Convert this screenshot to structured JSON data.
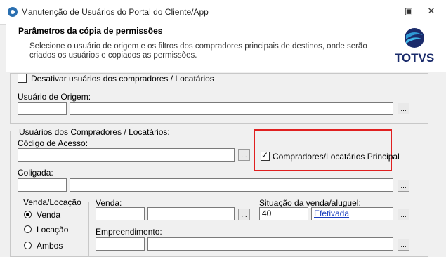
{
  "window": {
    "title": "Manutenção de Usuários do Portal do Cliente/App",
    "restore_icon": "restore-icon",
    "close_icon": "close-icon"
  },
  "header": {
    "title": "Parâmetros da cópia de permissões",
    "description": "Selecione o usuário de origem e os filtros dos compradores principais de destinos, onde serão criados os usuários e copiados as permissões.",
    "logo_text": "TOTVS",
    "logo_color": "#1a2b6b"
  },
  "origin": {
    "deactivate_label": "Desativar usuários dos compradores / Locatários",
    "user_label": "Usuário de Origem:",
    "lookup": "..."
  },
  "buyers": {
    "group_label": "Usuários dos Compradores / Locatários:",
    "access_code_label": "Código de Acesso:",
    "principal_label": "Compradores/Locatários Principal",
    "coligada_label": "Coligada:",
    "lookup": "..."
  },
  "venda_locacao": {
    "group_label": "Venda/Locação",
    "options": [
      "Venda",
      "Locação",
      "Ambos"
    ],
    "selected": "Venda"
  },
  "sale": {
    "venda_label": "Venda:",
    "situacao_label": "Situação da venda/aluguel:",
    "situacao_code": "40",
    "situacao_desc": "Efetivada",
    "empreendimento_label": "Empreendimento:",
    "lookup": "..."
  },
  "colors": {
    "highlight": "#e02020",
    "link": "#1a3fbf"
  }
}
